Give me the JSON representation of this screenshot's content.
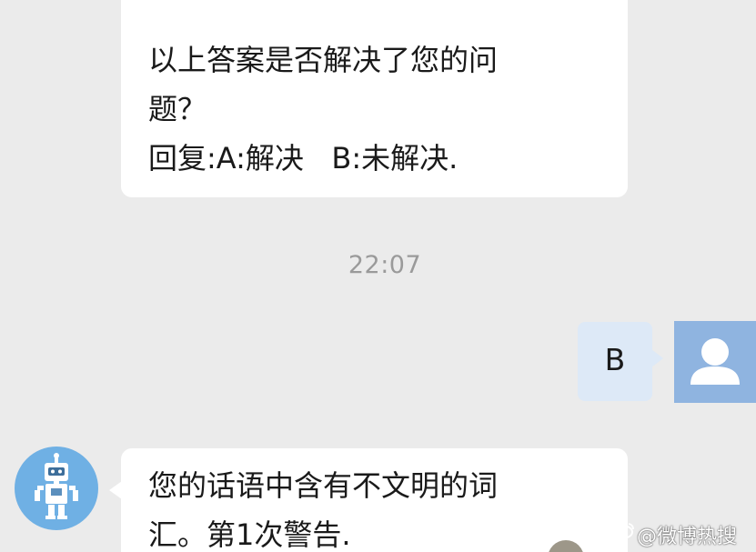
{
  "messages": [
    {
      "sender": "bot",
      "lines": [
        "以上答案是否解决了您的问",
        "题？",
        "回复:A:解决   B:未解决."
      ]
    },
    {
      "type": "timestamp",
      "time": "22:07"
    },
    {
      "sender": "user",
      "text": "B"
    },
    {
      "sender": "bot",
      "lines": [
        "您的话语中含有不文明的词",
        "汇。第1次警告."
      ]
    }
  ],
  "avatars": {
    "bot": "robot-icon",
    "user": "user-silhouette-icon"
  },
  "watermark": {
    "text": "@微博热搜"
  },
  "colors": {
    "background": "#ebebeb",
    "bot_bubble": "#ffffff",
    "user_bubble": "#dde9f7",
    "user_avatar": "#8fb4e0",
    "bot_avatar": "#6fb0e4",
    "timestamp": "#9a9a9a"
  }
}
